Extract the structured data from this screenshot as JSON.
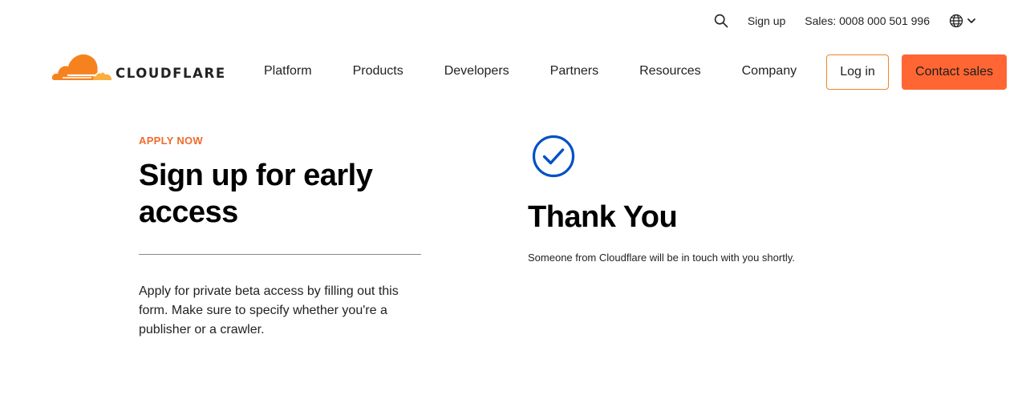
{
  "utility_bar": {
    "search_icon": "search-icon",
    "signup_label": "Sign up",
    "sales_label": "Sales: 0008 000 501 996",
    "language_icon": "globe-icon"
  },
  "brand": {
    "name": "CLOUDFLARE",
    "colors": {
      "orange": "#f6821f",
      "light_orange": "#fbad41",
      "accent": "#ff6633"
    }
  },
  "nav": {
    "items": [
      "Platform",
      "Products",
      "Developers",
      "Partners",
      "Resources",
      "Company"
    ],
    "login_label": "Log in",
    "contact_label": "Contact sales"
  },
  "main": {
    "eyebrow": "APPLY NOW",
    "headline": "Sign up for early access",
    "description": "Apply for private beta access by filling out this form. Make sure to specify whether you're a publisher or a crawler."
  },
  "confirmation": {
    "icon": "check-circle-icon",
    "title": "Thank You",
    "message": "Someone from Cloudflare will be in touch with you shortly.",
    "icon_color": "#0051c3"
  }
}
